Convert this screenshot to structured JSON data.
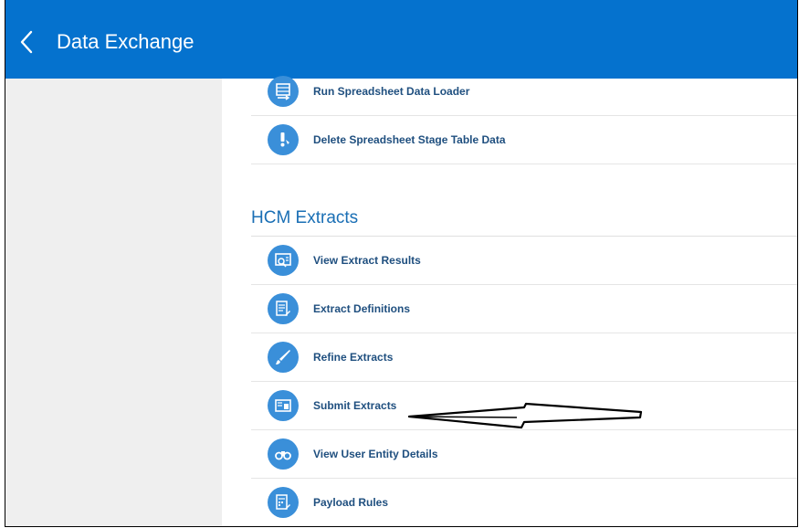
{
  "header": {
    "back_icon": "chevron-left-icon",
    "title": "Data Exchange"
  },
  "colors": {
    "header_bg": "#0572ce",
    "icon_bg": "#3a8fd9",
    "link_text": "#1f4f7f",
    "section_title": "#1a6fb5",
    "sidebar_bg": "#efefef"
  },
  "spreadsheet_tasks": [
    {
      "label": "Run Spreadsheet Data Loader",
      "icon": "spreadsheet-loader-icon"
    },
    {
      "label": "Delete Spreadsheet Stage Table Data",
      "icon": "delete-stage-data-icon"
    }
  ],
  "hcm_extracts": {
    "title": "HCM Extracts",
    "items": [
      {
        "label": "View Extract Results",
        "icon": "view-results-icon"
      },
      {
        "label": "Extract Definitions",
        "icon": "extract-definitions-icon"
      },
      {
        "label": "Refine Extracts",
        "icon": "brush-icon"
      },
      {
        "label": "Submit Extracts",
        "icon": "submit-extracts-icon"
      },
      {
        "label": "View User Entity Details",
        "icon": "binoculars-icon"
      },
      {
        "label": "Payload Rules",
        "icon": "payload-rules-icon"
      }
    ]
  },
  "annotation": {
    "icon": "pointer-arrow-annotation"
  }
}
